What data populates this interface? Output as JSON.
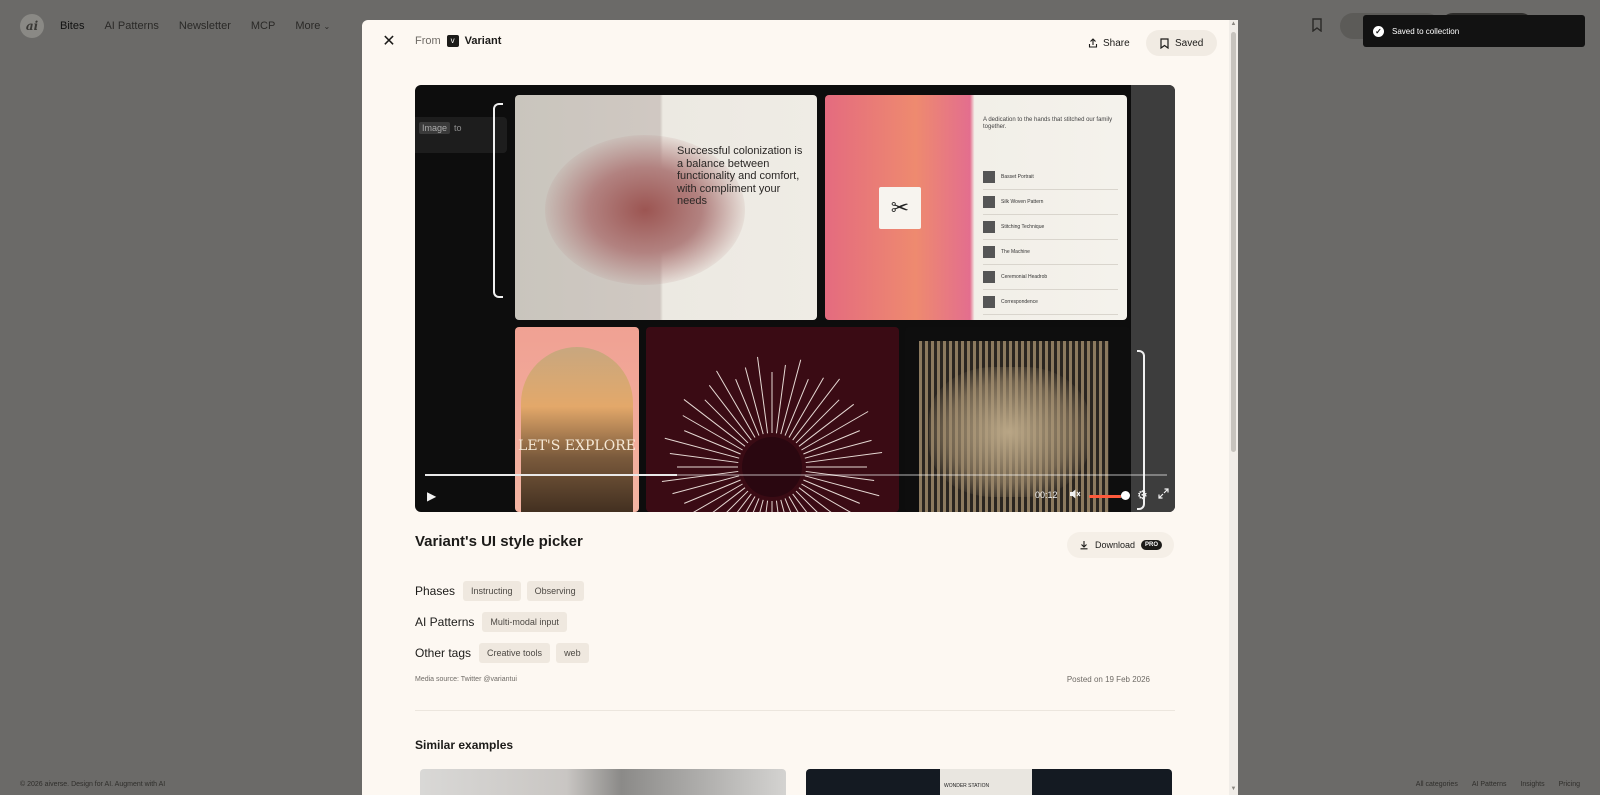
{
  "background": {
    "logo": "ai",
    "nav": [
      "Bites",
      "AI Patterns",
      "Newsletter",
      "MCP",
      "More"
    ],
    "footer_left": "© 2026 aiverse. Design for AI. Augment with AI",
    "footer_links": [
      "All categories",
      "AI Patterns",
      "Insights",
      "Pricing"
    ]
  },
  "modal": {
    "from_label": "From",
    "from_name": "Variant",
    "share_label": "Share",
    "saved_label": "Saved",
    "video": {
      "current_time": "00:12",
      "progress_fraction": 0.34,
      "volume_fraction": 0.85,
      "input_chip": "Image",
      "input_text": "to",
      "tile_heading": "Successful colonization is a balance between functionality and comfort, with compliment your needs",
      "tile_explore": "LET'S EXPLORE",
      "tile_intro": "A dedication to the hands that stitched our family together.",
      "tile_rows": [
        "Basset Portrait",
        "Silk Woven Pattern",
        "Stitching Technique",
        "The Machine",
        "Ceremonial Headrob",
        "Correspondence"
      ]
    },
    "title": "Variant's UI style picker",
    "download_label": "Download",
    "pro_badge": "PRO",
    "phases_label": "Phases",
    "phases": [
      "Instructing",
      "Observing"
    ],
    "ai_patterns_label": "AI Patterns",
    "ai_patterns": [
      "Multi-modal input"
    ],
    "other_tags_label": "Other tags",
    "other_tags": [
      "Creative tools",
      "web"
    ],
    "media_source": "Media source: Twitter @variantui",
    "posted": "Posted on 19 Feb 2026",
    "similar_title": "Similar examples",
    "similar_screen_text": "WONDER STATION"
  },
  "toast": {
    "text": "Saved to collection"
  },
  "colors": {
    "modal_bg": "#fdf8f2",
    "overlay": "#6b6a68",
    "volume_accent": "#ff5a3c"
  }
}
